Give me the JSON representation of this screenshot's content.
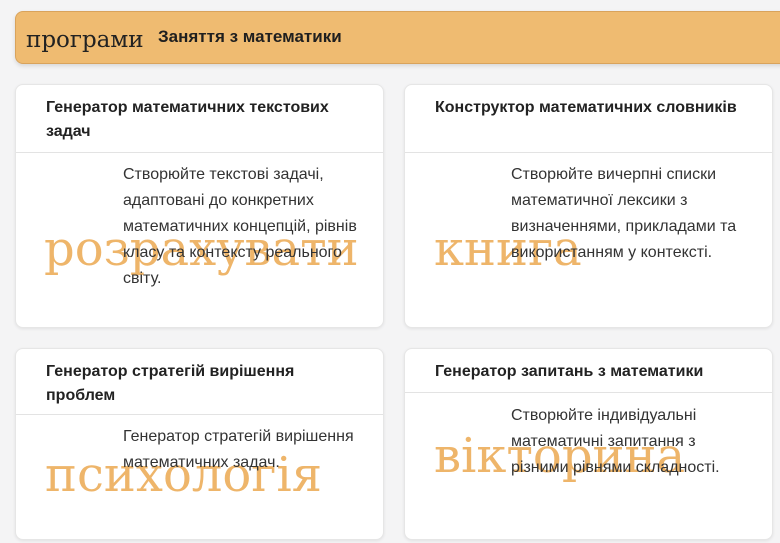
{
  "header": {
    "icon_text": "програми",
    "title": "Заняття з математики"
  },
  "cards": [
    {
      "title": "Генератор математичних текстових задач",
      "icon_text": "розрахувати",
      "description": "Створюйте текстові задачі, адаптовані до конкретних математичних концепцій, рівнів класу та контексту реального світу."
    },
    {
      "title": "Конструктор математичних словників",
      "icon_text": "книга",
      "description": "Створюйте вичерпні списки математичної лексики з визначеннями, прикладами та використанням у контексті."
    },
    {
      "title": "Генератор стратегій вирішення проблем",
      "icon_text": "психологія",
      "description": "Генератор стратегій вирішення математичних задач."
    },
    {
      "title": "Генератор запитань з математики",
      "icon_text": "вікторина",
      "description": "Створюйте індивідуальні математичні запитання з різними рівнями складності."
    }
  ]
}
